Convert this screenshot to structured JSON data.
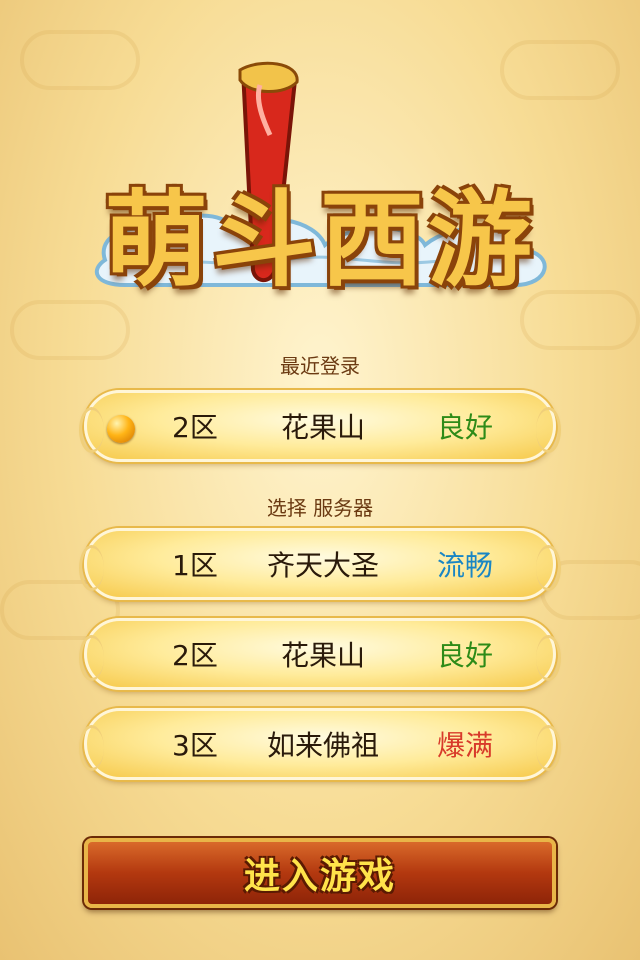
{
  "logo": {
    "title": "萌斗西游"
  },
  "recent": {
    "label": "最近登录",
    "server": {
      "zone": "2区",
      "name": "花果山",
      "status": "良好",
      "status_color": "#2e8b18"
    }
  },
  "select": {
    "label": "选择 服务器",
    "servers": [
      {
        "zone": "1区",
        "name": "齐天大圣",
        "status": "流畅",
        "status_color": "#1a86c4"
      },
      {
        "zone": "2区",
        "name": "花果山",
        "status": "良好",
        "status_color": "#2e8b18"
      },
      {
        "zone": "3区",
        "name": "如来佛祖",
        "status": "爆满",
        "status_color": "#d83a2a"
      }
    ]
  },
  "enter_button": {
    "label": "进入游戏"
  }
}
